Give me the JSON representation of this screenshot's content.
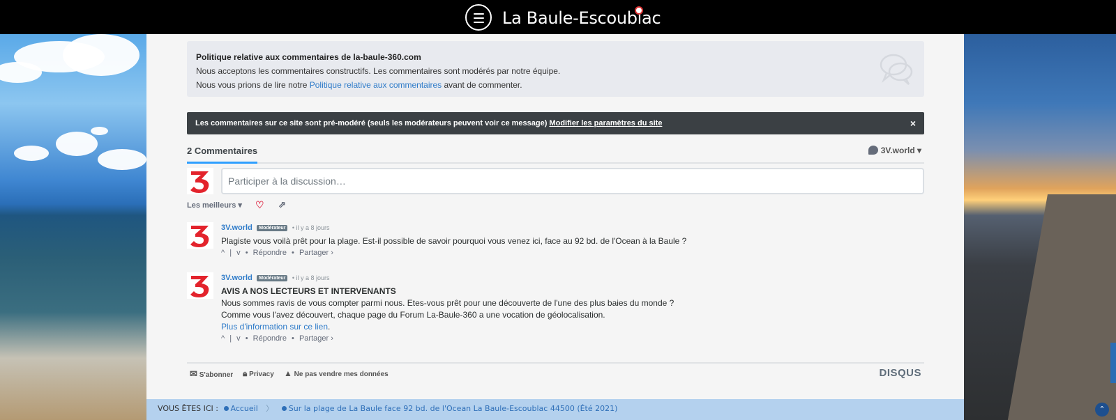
{
  "header": {
    "site_title": "La Baule-Escoublac"
  },
  "policy": {
    "title": "Politique relative aux commentaires de la-baule-360.com",
    "line1": "Nous acceptons les commentaires constructifs. Les commentaires sont modérés par notre équipe.",
    "line2_before": "Nous vous prions de lire notre ",
    "line2_link": "Politique relative aux commentaires",
    "line2_after": " avant de commenter."
  },
  "alert": {
    "text": "Les commentaires sur ce site sont pré-modéré (seuls les modérateurs peuvent voir ce message) ",
    "link": "Modifier les paramètres du site",
    "close": "×"
  },
  "tabs": {
    "count_label": "2 Commentaires",
    "user_label": "3V.world ▾"
  },
  "composer": {
    "placeholder": "Participer à la discussion…"
  },
  "sort": {
    "label": "Les meilleurs ▾",
    "heart_icon": "heart-icon",
    "share_icon": "share-icon"
  },
  "comments": [
    {
      "author": "3V.world",
      "badge": "Modérateur",
      "time": "• il y a 8 jours",
      "heading": "",
      "lines": [
        "Plagiste vous voilà prêt pour la plage. Est-il possible de savoir pourquoi vous venez ici, face au 92 bd. de l'Ocean à la Baule ?"
      ],
      "link": "",
      "vote_up": "^",
      "vote_sep": "|",
      "vote_down": "v",
      "reply": "Répondre",
      "share": "Partager ›"
    },
    {
      "author": "3V.world",
      "badge": "Modérateur",
      "time": "• il y a 8 jours",
      "heading": "AVIS A NOS LECTEURS ET INTERVENANTS",
      "lines": [
        "Nous sommes ravis de vous compter parmi nous. Etes-vous prêt pour une découverte de l'une des plus baies du monde ?",
        "Comme vous l'avez découvert, chaque page du Forum La-Baule-360 a une vocation de géolocalisation."
      ],
      "link": "Plus d'information sur ce lien",
      "vote_up": "^",
      "vote_sep": "|",
      "vote_down": "v",
      "reply": "Répondre",
      "share": "Partager ›"
    }
  ],
  "footer": {
    "subscribe": "S'abonner",
    "privacy": "Privacy",
    "do_not_sell": "Ne pas vendre mes données",
    "brand": "DISQUS"
  },
  "breadcrumb": {
    "prefix": "VOUS ÊTES ICI :",
    "home": "Accueil",
    "current": "Sur la plage de La Baule face 92 bd. de l'Ocean La Baule-Escoublac 44500 (Été 2021)"
  },
  "colors": {
    "accent": "#2e7bc9",
    "alert_bg": "#3b4044",
    "logo_red": "#e3232c"
  }
}
